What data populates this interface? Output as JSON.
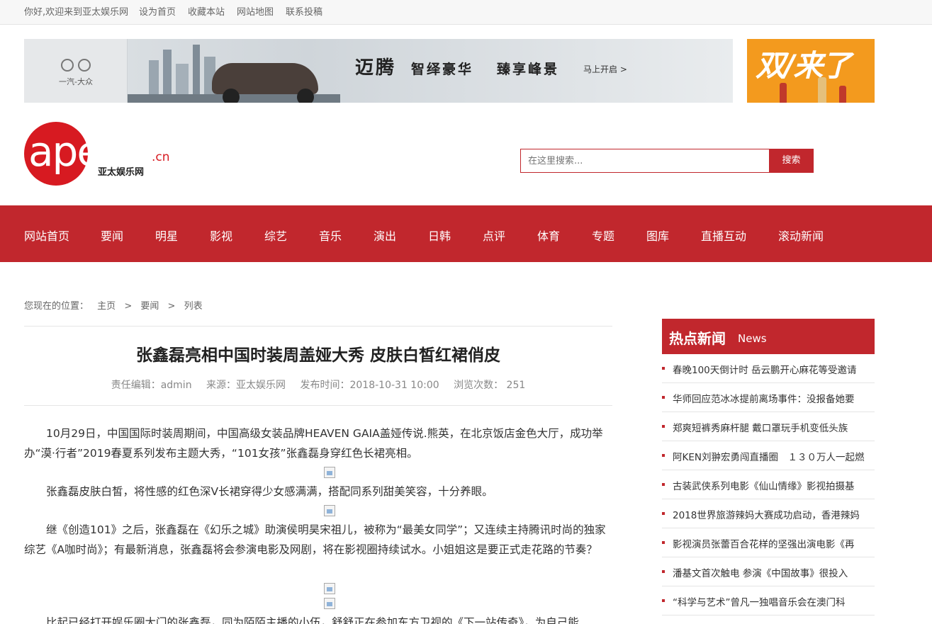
{
  "topbar": {
    "welcome": "你好,欢迎来到亚太娱乐网",
    "links": [
      "设为首页",
      "收藏本站",
      "网站地图",
      "联系投稿"
    ]
  },
  "ads": {
    "main_brand_logo_text": "一汽-大众",
    "main_headline": "迈腾",
    "main_slogan_1": "智绎豪华",
    "main_slogan_2": "臻享峰景",
    "main_cta": "马上开启 >",
    "side_text": "双/来了"
  },
  "logo": {
    "word": "apent",
    "domain_suffix": ".cn",
    "site_name": "亚太娱乐网"
  },
  "search": {
    "placeholder": "在这里搜索...",
    "button_label": "搜索"
  },
  "nav": {
    "items": [
      "网站首页",
      "要闻",
      "明星",
      "影视",
      "综艺",
      "音乐",
      "演出",
      "日韩",
      "点评",
      "体育",
      "专题",
      "图库",
      "直播互动",
      "滚动新闻"
    ]
  },
  "breadcrumb": {
    "prefix": "您现在的位置：",
    "home": "主页",
    "sep": ">",
    "section": "要闻",
    "current": "列表"
  },
  "article": {
    "title": "张鑫磊亮相中国时装周盖娅大秀 皮肤白皙红裙俏皮",
    "editor": "责任编辑：admin",
    "source": "来源：亚太娱乐网",
    "published": "发布时间：2018-10-31 10:00",
    "views": "浏览次数： 251",
    "paragraphs": [
      "10月29日，中国国际时装周期间，中国高级女装品牌HEAVEN GAIA盖娅传说.熊英，在北京饭店金色大厅，成功举办“漠·行者”2019春夏系列发布主题大秀，“101女孩”张鑫磊身穿红色长裙亮相。",
      "张鑫磊皮肤白皙，将性感的红色深V长裙穿得少女感满满，搭配同系列甜美笑容，十分养眼。",
      "继《创造101》之后，张鑫磊在《幻乐之城》助演侯明昊宋祖儿，被称为“最美女同学”；又连续主持腾讯时尚的独家综艺《A咖时尚》；有最新消息，张鑫磊将会参演电影及网剧，将在影视圈持续试水。小姐姐这是要正式走花路的节奏？",
      "比起已经打开娱乐圈大门的张鑫磊，同为陌陌主播的小伍，舒舒正在参加东方卫视的《下一站传奇》，为自己能"
    ]
  },
  "hot_news": {
    "title": "热点新闻",
    "title_en": "News",
    "items": [
      "春晚100天倒计时 岳云鹏开心麻花等受邀请",
      "华师回应范冰冰提前离场事件：没报备她要",
      "郑爽短裤秀麻杆腿 戴口罩玩手机变低头族",
      "阿KEN刘翀宏勇闯直播圈　１３０万人一起燃",
      "古装武侠系列电影《仙山情缘》影视拍摄基",
      "2018世界旅游辣妈大赛成功启动，香港辣妈",
      "影视演员张蕾百合花样的坚强出演电影《再",
      "潘基文首次触电 参演《中国故事》很投入",
      "“科学与艺术”曾凡一独唱音乐会在澳门科"
    ]
  },
  "colors": {
    "brand_red": "#c1272d",
    "logo_red": "#d71a21"
  }
}
